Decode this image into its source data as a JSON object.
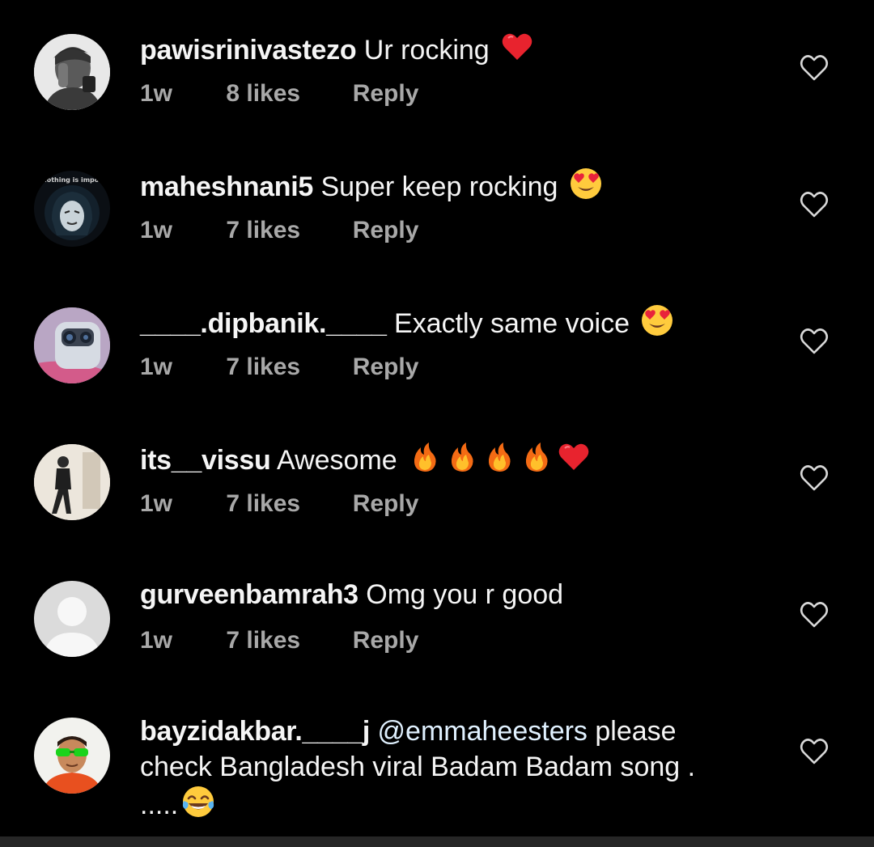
{
  "comments": [
    {
      "username": "pawisrinivastezo",
      "text": "Ur rocking",
      "emojis": [
        "red-heart-emoji"
      ],
      "time": "1w",
      "likes": "8 likes",
      "reply": "Reply",
      "avatar": "avatar-photo-man-grayscale"
    },
    {
      "username": "maheshnani5",
      "text": "Super keep rocking",
      "emojis": [
        "heart-eyes-emoji"
      ],
      "time": "1w",
      "likes": "7 likes",
      "reply": "Reply",
      "avatar": "avatar-masked-hacker",
      "avatar_text": "nothing is impo"
    },
    {
      "username": "____.dipbanik.____",
      "text": "Exactly same voice",
      "emojis": [
        "heart-eyes-emoji"
      ],
      "time": "1w",
      "likes": "7 likes",
      "reply": "Reply",
      "avatar": "avatar-phone-camera"
    },
    {
      "username": "its__vissu",
      "text": "Awesome",
      "emojis": [
        "fire-emoji",
        "fire-emoji",
        "fire-emoji",
        "fire-emoji",
        "red-heart-emoji"
      ],
      "time": "1w",
      "likes": "7 likes",
      "reply": "Reply",
      "avatar": "avatar-person-standing"
    },
    {
      "username": "gurveenbamrah3",
      "text": "Omg you r good",
      "emojis": [],
      "time": "1w",
      "likes": "7 likes",
      "reply": "Reply",
      "avatar": "avatar-default-placeholder"
    },
    {
      "username": "bayzidakbar.____j",
      "mention": "@emmaheesters",
      "text": " please check Bangladesh viral Badam Badam song . .....",
      "emojis": [
        "tears-of-joy-emoji"
      ],
      "avatar": "avatar-man-green-sunglasses"
    }
  ],
  "icons": {
    "like": "heart-outline-icon"
  },
  "colors": {
    "background": "#000000",
    "primary_text": "#f5f5f5",
    "secondary_text": "#a8a8a8",
    "mention": "#e0f1ff",
    "bottom_bar": "#262626"
  }
}
